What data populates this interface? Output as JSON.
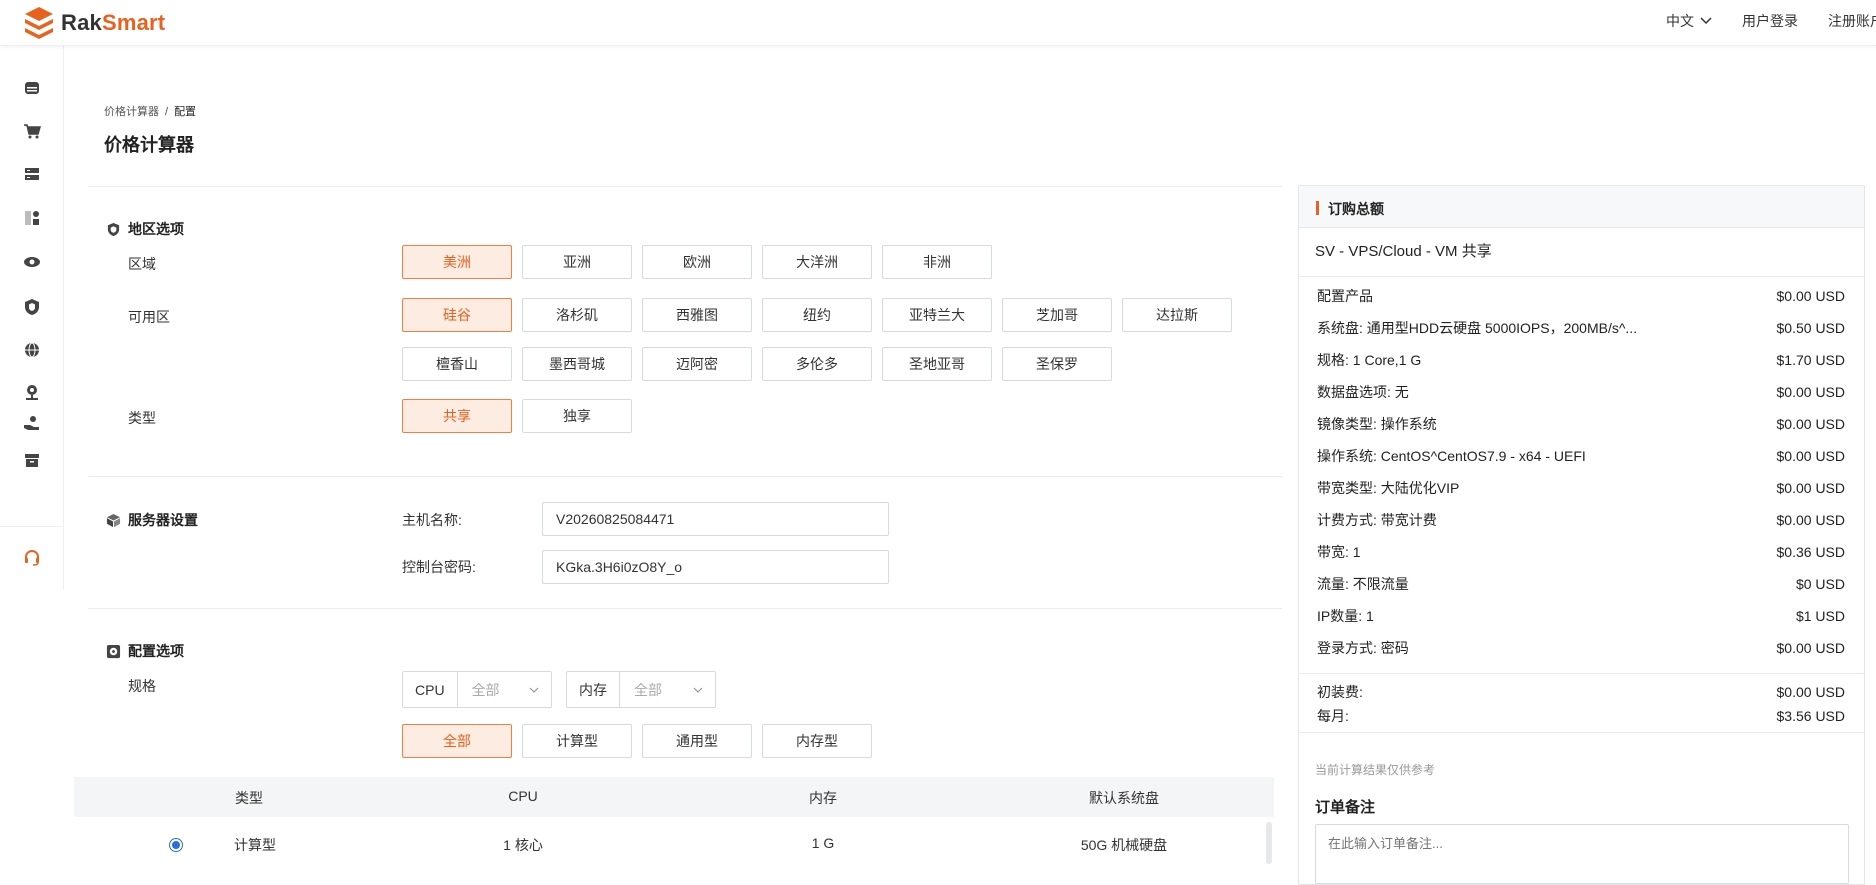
{
  "brand": {
    "part1": "Rak",
    "part2": "Smart",
    "accent": "#e8611e"
  },
  "topnav": {
    "language": "中文",
    "login": "用户登录",
    "register": "注册账户"
  },
  "sidebar": {
    "icons": [
      "server-icon",
      "cart-icon",
      "storage-icon",
      "apps-icon",
      "eye-icon",
      "shield-icon",
      "globe-icon",
      "location-icon",
      "support-hand-icon",
      "archive-icon",
      "headset-icon"
    ]
  },
  "breadcrumb": {
    "parent": "价格计算器",
    "separator": "/",
    "current": "配置"
  },
  "page": {
    "title": "价格计算器"
  },
  "region": {
    "title": "地区选项",
    "area_label": "区域",
    "areas": [
      "美洲",
      "亚洲",
      "欧洲",
      "大洋洲",
      "非洲"
    ],
    "zone_label": "可用区",
    "zones_row1": [
      "硅谷",
      "洛杉矶",
      "西雅图",
      "纽约",
      "亚特兰大",
      "芝加哥",
      "达拉斯"
    ],
    "zones_row2": [
      "檀香山",
      "墨西哥城",
      "迈阿密",
      "多伦多",
      "圣地亚哥",
      "圣保罗"
    ],
    "type_label": "类型",
    "types": [
      "共享",
      "独享"
    ]
  },
  "server": {
    "title": "服务器设置",
    "hostname_label": "主机名称:",
    "hostname_value": "V20260825084471",
    "password_label": "控制台密码:",
    "password_value": "KGka.3H6i0zO8Y_o"
  },
  "config": {
    "title": "配置选项",
    "spec_label": "规格",
    "cpu_label": "CPU",
    "cpu_value": "全部",
    "mem_label": "内存",
    "mem_value": "全部",
    "categories": [
      "全部",
      "计算型",
      "通用型",
      "内存型"
    ],
    "table_headers": [
      "类型",
      "CPU",
      "内存",
      "默认系统盘"
    ],
    "rows": [
      {
        "type": "计算型",
        "cpu": "1 核心",
        "mem": "1 G",
        "disk": "50G 机械硬盘"
      }
    ]
  },
  "summary": {
    "title": "订购总额",
    "product": "SV - VPS/Cloud - VM 共享",
    "items": [
      {
        "k": "配置产品",
        "v": "$0.00 USD"
      },
      {
        "k": "系统盘: 通用型HDD云硬盘 5000IOPS，200MB/s^...",
        "v": "$0.50 USD"
      },
      {
        "k": "规格: 1 Core,1 G",
        "v": "$1.70 USD"
      },
      {
        "k": "数据盘选项: 无",
        "v": "$0.00 USD"
      },
      {
        "k": "镜像类型: 操作系统",
        "v": "$0.00 USD"
      },
      {
        "k": "操作系统: CentOS^CentOS7.9 - x64 - UEFI",
        "v": "$0.00 USD"
      },
      {
        "k": "带宽类型: 大陆优化VIP",
        "v": "$0.00 USD"
      },
      {
        "k": "计费方式: 带宽计费",
        "v": "$0.00 USD"
      },
      {
        "k": "带宽: 1",
        "v": "$0.36 USD"
      },
      {
        "k": "流量: 不限流量",
        "v": "$0 USD"
      },
      {
        "k": "IP数量: 1",
        "v": "$1 USD"
      },
      {
        "k": "登录方式: 密码",
        "v": "$0.00 USD"
      }
    ],
    "setup_label": "初装费:",
    "setup_value": "$0.00 USD",
    "monthly_label": "每月:",
    "monthly_value": "$3.56 USD",
    "disclaimer": "当前计算结果仅供参考",
    "order_note_title": "订单备注",
    "order_note_placeholder": "在此输入订单备注..."
  }
}
